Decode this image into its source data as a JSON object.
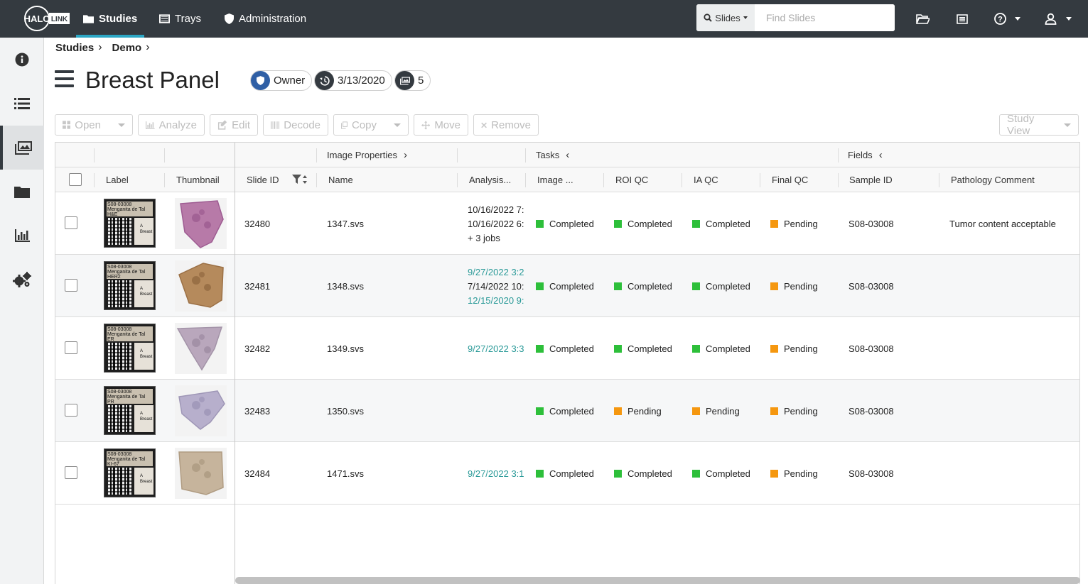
{
  "nav": {
    "logo_text": "HALO",
    "logo_sub": "LINK",
    "items": [
      {
        "label": "Studies"
      },
      {
        "label": "Trays"
      },
      {
        "label": "Administration"
      }
    ],
    "search_type": "Slides",
    "search_placeholder": "Find Slides"
  },
  "breadcrumb": [
    "Studies",
    "Demo"
  ],
  "page": {
    "title": "Breast Panel",
    "owner": "Owner",
    "date": "3/13/2020",
    "image_count": "5"
  },
  "toolbar": {
    "open": "Open",
    "analyze": "Analyze",
    "edit": "Edit",
    "decode": "Decode",
    "copy": "Copy",
    "move": "Move",
    "remove": "Remove",
    "study_view": "Study View"
  },
  "grid": {
    "groups": {
      "image_properties": "Image Properties",
      "tasks": "Tasks",
      "fields": "Fields"
    },
    "columns": {
      "label": "Label",
      "thumbnail": "Thumbnail",
      "slide_id": "Slide ID",
      "name": "Name",
      "analysis": "Analysis...",
      "image": "Image ...",
      "roi_qc": "ROI QC",
      "ia_qc": "IA QC",
      "final_qc": "Final QC",
      "sample_id": "Sample ID",
      "pathology_comment": "Pathology Comment"
    },
    "rows": [
      {
        "label_text": "S08-03008 Menganita de Tal H&E",
        "slide_id": "32480",
        "name": "1347.svs",
        "analysis": [
          "10/16/2022 7:",
          "10/16/2022 6:",
          "+ 3 jobs"
        ],
        "image": "Completed",
        "roi_qc": "Completed",
        "ia_qc": "Completed",
        "final_qc": "Pending",
        "sample_id": "S08-03008",
        "pathology_comment": "Tumor content acceptable"
      },
      {
        "label_text": "S08-03008 Menganita de Tal HER2",
        "slide_id": "32481",
        "name": "1348.svs",
        "analysis": [
          "9/27/2022 3:2",
          "7/14/2022 10:",
          "12/15/2020 9:"
        ],
        "image": "Completed",
        "roi_qc": "Completed",
        "ia_qc": "Completed",
        "final_qc": "Pending",
        "sample_id": "S08-03008",
        "pathology_comment": ""
      },
      {
        "label_text": "S08-03008 Menganita de Tal ER",
        "slide_id": "32482",
        "name": "1349.svs",
        "analysis": [
          "9/27/2022 3:3"
        ],
        "image": "Completed",
        "roi_qc": "Completed",
        "ia_qc": "Completed",
        "final_qc": "Pending",
        "sample_id": "S08-03008",
        "pathology_comment": ""
      },
      {
        "label_text": "S08-03008 Menganita de Tal PR",
        "slide_id": "32483",
        "name": "1350.svs",
        "analysis": [],
        "image": "Completed",
        "roi_qc": "Pending",
        "ia_qc": "Pending",
        "final_qc": "Pending",
        "sample_id": "S08-03008",
        "pathology_comment": ""
      },
      {
        "label_text": "S08-03008 Menganita de Tal KI-67",
        "slide_id": "32484",
        "name": "1471.svs",
        "analysis": [
          "9/27/2022 3:1"
        ],
        "image": "Completed",
        "roi_qc": "Completed",
        "ia_qc": "Completed",
        "final_qc": "Pending",
        "sample_id": "S08-03008",
        "pathology_comment": ""
      }
    ]
  },
  "colors": {
    "nav_bg": "#343a40",
    "accent": "#2ba6c4",
    "completed": "#2dbf3a",
    "pending": "#f5970f",
    "link": "#2a9a98"
  }
}
